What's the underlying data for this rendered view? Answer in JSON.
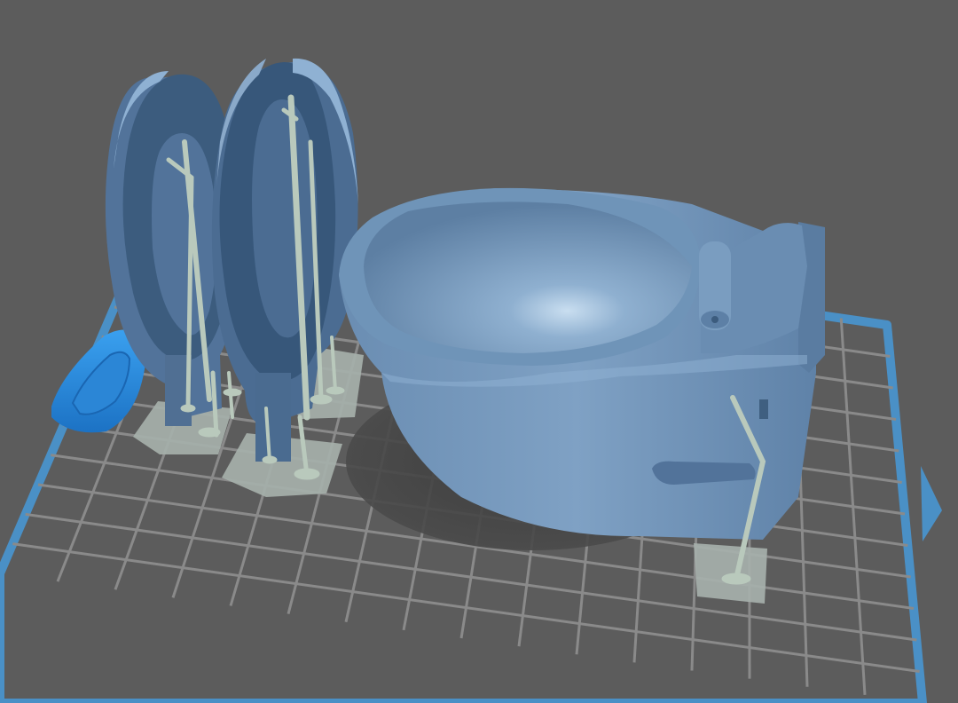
{
  "viewport": {
    "background_color": "#5c5c5c",
    "plate_border_color": "#4a90c6",
    "grid_color": "#8a8a8a",
    "model_color": "#6f94b8",
    "model_highlight_color": "#a9c7e3",
    "model_shadow_color": "#3f5f80",
    "selected_part_color": "#2d8fe0",
    "support_color": "#b9c9bc",
    "raft_color": "#a6b0ab",
    "plate_direction_icon": "triangle-right-icon"
  },
  "scene_objects": [
    {
      "name": "toilet-bowl"
    },
    {
      "name": "toilet-seat-ring-left"
    },
    {
      "name": "toilet-seat-ring-right"
    },
    {
      "name": "flush-handle-part"
    },
    {
      "name": "support-structures"
    }
  ]
}
